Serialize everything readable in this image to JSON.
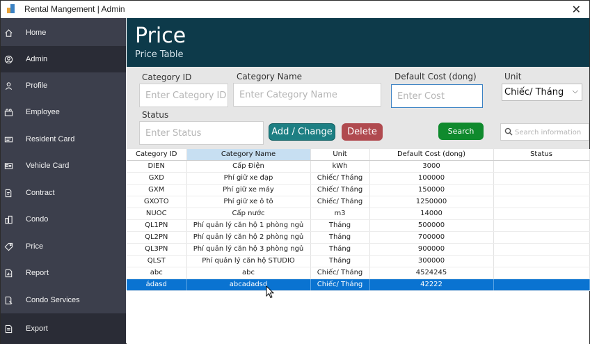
{
  "window": {
    "title": "Rental Mangement | Admin"
  },
  "sidebar": {
    "items": [
      {
        "label": "Home",
        "icon": "home-icon"
      },
      {
        "label": "Admin",
        "icon": "user-circle-icon"
      },
      {
        "label": "Profile",
        "icon": "person-icon"
      },
      {
        "label": "Employee",
        "icon": "group-icon"
      },
      {
        "label": "Resident Card",
        "icon": "card-icon"
      },
      {
        "label": "Vehicle Card",
        "icon": "id-card-icon"
      },
      {
        "label": "Contract",
        "icon": "document-edit-icon"
      },
      {
        "label": "Condo",
        "icon": "building-icon"
      },
      {
        "label": "Price",
        "icon": "tag-icon"
      },
      {
        "label": "Report",
        "icon": "report-icon"
      },
      {
        "label": "Condo Services",
        "icon": "services-icon"
      },
      {
        "label": "Export",
        "icon": "export-icon"
      }
    ]
  },
  "header": {
    "title": "Price",
    "subtitle": "Price Table"
  },
  "form": {
    "category_id": {
      "label": "Category ID",
      "placeholder": "Enter Category ID"
    },
    "category_name": {
      "label": "Category Name",
      "placeholder": "Enter Category Name"
    },
    "default_cost": {
      "label": "Default Cost (dong)",
      "placeholder": "Enter Cost"
    },
    "unit": {
      "label": "Unit",
      "value": "Chiếc/ Tháng"
    },
    "status": {
      "label": "Status",
      "placeholder": "Enter Status"
    },
    "add_label": "Add / Change",
    "delete_label": "Delete",
    "search_label": "Search",
    "search_placeholder": "Search information"
  },
  "table": {
    "columns": [
      "Category ID",
      "Category Name",
      "Unit",
      "Default Cost (dong)",
      "Status"
    ],
    "rows": [
      [
        "DIEN",
        "Cấp Điện",
        "kWh",
        "3000",
        ""
      ],
      [
        "GXD",
        "Phí giữ xe đạp",
        "Chiếc/ Tháng",
        "100000",
        ""
      ],
      [
        "GXM",
        "Phí giữ xe máy",
        "Chiếc/ Tháng",
        "150000",
        ""
      ],
      [
        "GXOTO",
        "Phí giữ xe ô tô",
        "Chiếc/ Tháng",
        "1250000",
        ""
      ],
      [
        "NUOC",
        "Cấp nước",
        "m3",
        "14000",
        ""
      ],
      [
        "QL1PN",
        "Phí quản lý căn hộ 1 phòng ngủ",
        "Tháng",
        "500000",
        ""
      ],
      [
        "QL2PN",
        "Phí quản lý căn hộ 2 phòng ngủ",
        "Tháng",
        "700000",
        ""
      ],
      [
        "QL3PN",
        "Phí quản lý căn hộ 3 phòng ngủ",
        "Tháng",
        "900000",
        ""
      ],
      [
        "QLST",
        "Phí quản lý căn hộ STUDIO",
        "Tháng",
        "300000",
        ""
      ],
      [
        "abc",
        "abc",
        "Chiếc/ Tháng",
        "4524245",
        ""
      ],
      [
        "ádasd",
        "abcadadsd",
        "Chiếc/ Tháng",
        "42222",
        ""
      ]
    ],
    "selected_row": 10
  },
  "colors": {
    "sidebar_bg": "#3c3f4c",
    "header_bg": "#0d3a4a",
    "form_bg": "#e6e6e6",
    "add_button": "#1d7f83",
    "delete_button": "#b04a4f",
    "search_button": "#0f8a2d",
    "selection": "#0a73d1"
  }
}
